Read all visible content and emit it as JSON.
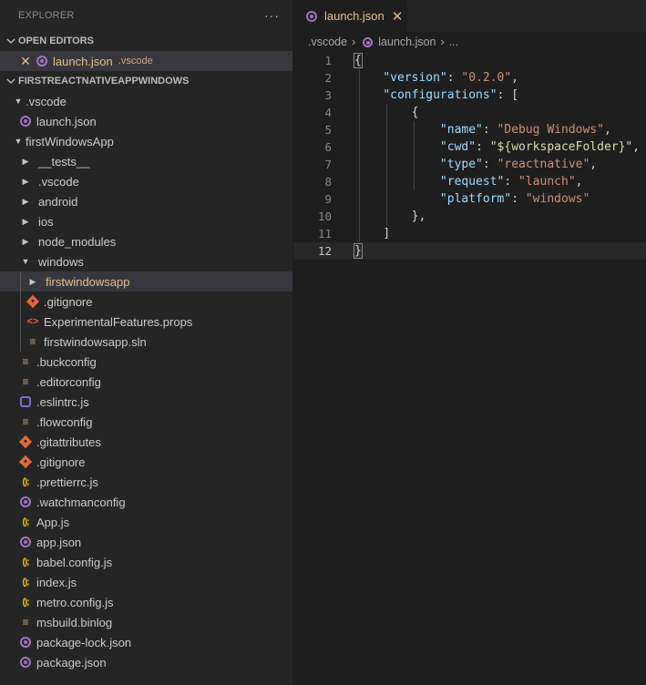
{
  "sidebar": {
    "title": "EXPLORER",
    "more": "···",
    "open_editors": {
      "title": "OPEN EDITORS",
      "items": [
        {
          "name": "launch.json",
          "description": ".vscode"
        }
      ]
    },
    "workspace": {
      "title": "FIRSTREACTNATIVEAPPWINDOWS",
      "tree": [
        {
          "label": ".vscode"
        },
        {
          "label": "launch.json"
        },
        {
          "label": "firstWindowsApp"
        },
        {
          "label": "__tests__"
        },
        {
          "label": ".vscode"
        },
        {
          "label": "android"
        },
        {
          "label": "ios"
        },
        {
          "label": "node_modules"
        },
        {
          "label": "windows"
        },
        {
          "label": "firstwindowsapp"
        },
        {
          "label": ".gitignore"
        },
        {
          "label": "ExperimentalFeatures.props"
        },
        {
          "label": "firstwindowsapp.sln"
        },
        {
          "label": ".buckconfig"
        },
        {
          "label": ".editorconfig"
        },
        {
          "label": ".eslintrc.js"
        },
        {
          "label": ".flowconfig"
        },
        {
          "label": ".gitattributes"
        },
        {
          "label": ".gitignore"
        },
        {
          "label": ".prettierrc.js"
        },
        {
          "label": ".watchmanconfig"
        },
        {
          "label": "App.js"
        },
        {
          "label": "app.json"
        },
        {
          "label": "babel.config.js"
        },
        {
          "label": "index.js"
        },
        {
          "label": "metro.config.js"
        },
        {
          "label": "msbuild.binlog"
        },
        {
          "label": "package-lock.json"
        },
        {
          "label": "package.json"
        }
      ]
    }
  },
  "editor": {
    "tab": {
      "label": "launch.json",
      "close": "✕"
    },
    "breadcrumb": {
      "folder": ".vscode",
      "file": "launch.json",
      "tail": "..."
    },
    "line_numbers": [
      "1",
      "2",
      "3",
      "4",
      "5",
      "6",
      "7",
      "8",
      "9",
      "10",
      "11",
      "12"
    ],
    "code": {
      "open_brace": "{",
      "version_key": "\"version\"",
      "version_val": "\"0.2.0\"",
      "configs_key": "\"configurations\"",
      "name_key": "\"name\"",
      "name_val": "\"Debug Windows\"",
      "cwd_key": "\"cwd\"",
      "cwd_val": "\"${workspaceFolder}\"",
      "type_key": "\"type\"",
      "type_val": "\"reactnative\"",
      "request_key": "\"request\"",
      "request_val": "\"launch\"",
      "platform_key": "\"platform\"",
      "platform_val": "\"windows\"",
      "close_obj": "},",
      "close_arr": "]",
      "close_brace": "}"
    }
  },
  "colors": {
    "modified": "#e2c08d",
    "json_icon": "#a074c4",
    "js_icon": "#f1c40f",
    "git_icon": "#e8663b"
  }
}
